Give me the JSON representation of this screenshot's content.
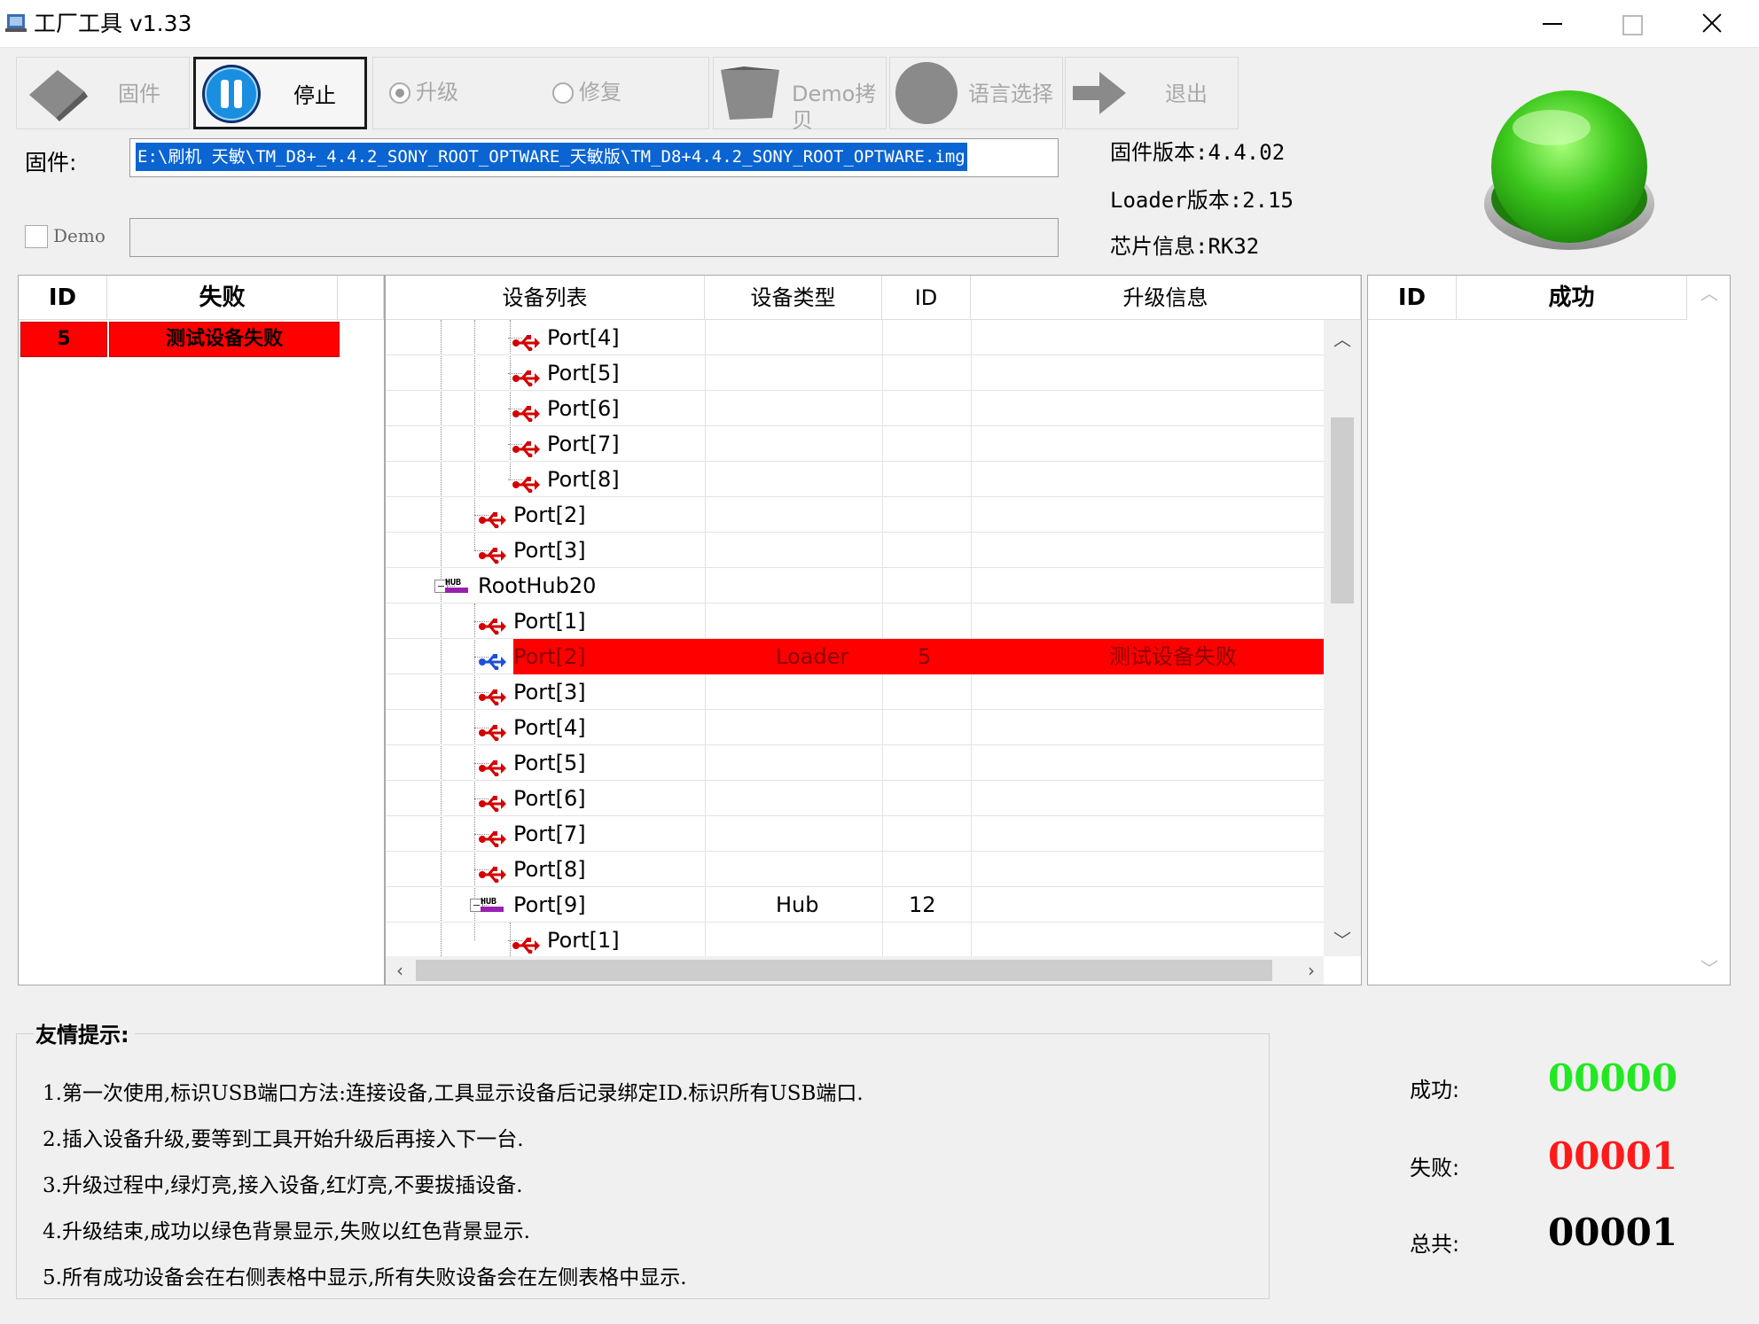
{
  "window": {
    "title": "工厂工具 v1.33"
  },
  "toolbar": {
    "firmware_label": "固件",
    "stop_label": "停止",
    "upgrade_label": "升级",
    "repair_label": "修复",
    "demo_copy_label": "Demo拷贝",
    "language_label": "语言选择",
    "exit_label": "退出"
  },
  "firmware": {
    "label": "固件:",
    "path": "E:\\刷机 天敏\\TM_D8+_4.4.2_SONY_ROOT_OPTWARE_天敏版\\TM_D8+4.4.2_SONY_ROOT_OPTWARE.img",
    "demo_label": "Demo"
  },
  "info": {
    "firmware_version": "固件版本:4.4.02",
    "loader_version": "Loader版本:2.15",
    "chip_info": "芯片信息:RK32"
  },
  "fail_table": {
    "headers": [
      "ID",
      "失败"
    ],
    "rows": [
      {
        "id": "5",
        "status": "测试设备失败"
      }
    ]
  },
  "success_table": {
    "headers": [
      "ID",
      "成功"
    ]
  },
  "device_table": {
    "headers": [
      "设备列表",
      "设备类型",
      "ID",
      "升级信息"
    ],
    "rows": [
      {
        "label": "Port[4]"
      },
      {
        "label": "Port[5]"
      },
      {
        "label": "Port[6]"
      },
      {
        "label": "Port[7]"
      },
      {
        "label": "Port[8]"
      },
      {
        "label": "Port[2]"
      },
      {
        "label": "Port[3]"
      },
      {
        "label": "RootHub20"
      },
      {
        "label": "Port[1]"
      },
      {
        "label": "Port[2]",
        "type": "Loader",
        "id": "5",
        "info": "测试设备失败"
      },
      {
        "label": "Port[3]"
      },
      {
        "label": "Port[4]"
      },
      {
        "label": "Port[5]"
      },
      {
        "label": "Port[6]"
      },
      {
        "label": "Port[7]"
      },
      {
        "label": "Port[8]"
      },
      {
        "label": "Port[9]",
        "type": "Hub",
        "id": "12"
      },
      {
        "label": "Port[1]"
      }
    ]
  },
  "tips": {
    "title": "友情提示:",
    "items": [
      "1.第一次使用,标识USB端口方法:连接设备,工具显示设备后记录绑定ID.标识所有USB端口.",
      "2.插入设备升级,要等到工具开始升级后再接入下一台.",
      "3.升级过程中,绿灯亮,接入设备,红灯亮,不要拔插设备.",
      "4.升级结束,成功以绿色背景显示,失败以红色背景显示.",
      "5.所有成功设备会在右侧表格中显示,所有失败设备会在左侧表格中显示."
    ]
  },
  "stats": {
    "success_label": "成功:",
    "success_value": "00000",
    "fail_label": "失败:",
    "fail_value": "00001",
    "total_label": "总共:",
    "total_value": "00001"
  },
  "colors": {
    "success": "#22e822",
    "fail": "#ff1a1a",
    "highlight": "#ff0000",
    "selection": "#0a64d2"
  },
  "icons": [
    "app-icon",
    "firmware-icon",
    "pause-icon",
    "demo-copy-icon",
    "language-icon",
    "exit-arrow-icon",
    "usb-icon",
    "hub-icon",
    "go-button-icon"
  ]
}
